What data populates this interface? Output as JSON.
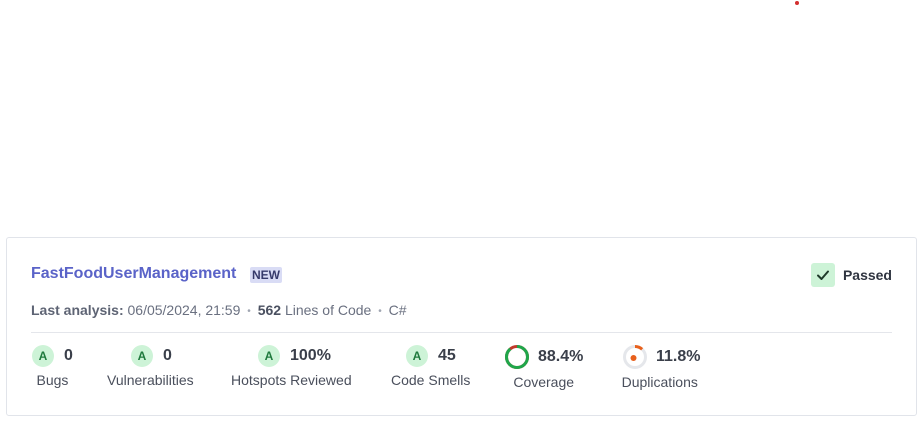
{
  "project": {
    "name": "FastFoodUserManagement",
    "badge": "NEW",
    "status": "Passed",
    "status_color": "#cdf3d7"
  },
  "analysis": {
    "prefix": "Last analysis:",
    "datetime": "06/05/2024, 21:59",
    "lines": "562",
    "lines_label": "Lines of Code",
    "language": "C#",
    "separator": "•"
  },
  "metrics": {
    "bugs": {
      "rating": "A",
      "value": "0",
      "label": "Bugs"
    },
    "vulnerabilities": {
      "rating": "A",
      "value": "0",
      "label": "Vulnerabilities"
    },
    "hotspots": {
      "rating": "A",
      "value": "100%",
      "label": "Hotspots Reviewed"
    },
    "code_smells": {
      "rating": "A",
      "value": "45",
      "label": "Code Smells"
    },
    "coverage": {
      "value": "88.4%",
      "label": "Coverage",
      "fraction": 0.884,
      "color": "#1fa64a",
      "rest_color": "#c0392b"
    },
    "duplications": {
      "value": "11.8%",
      "label": "Duplications",
      "fraction": 0.118,
      "color": "#e8601c"
    }
  }
}
